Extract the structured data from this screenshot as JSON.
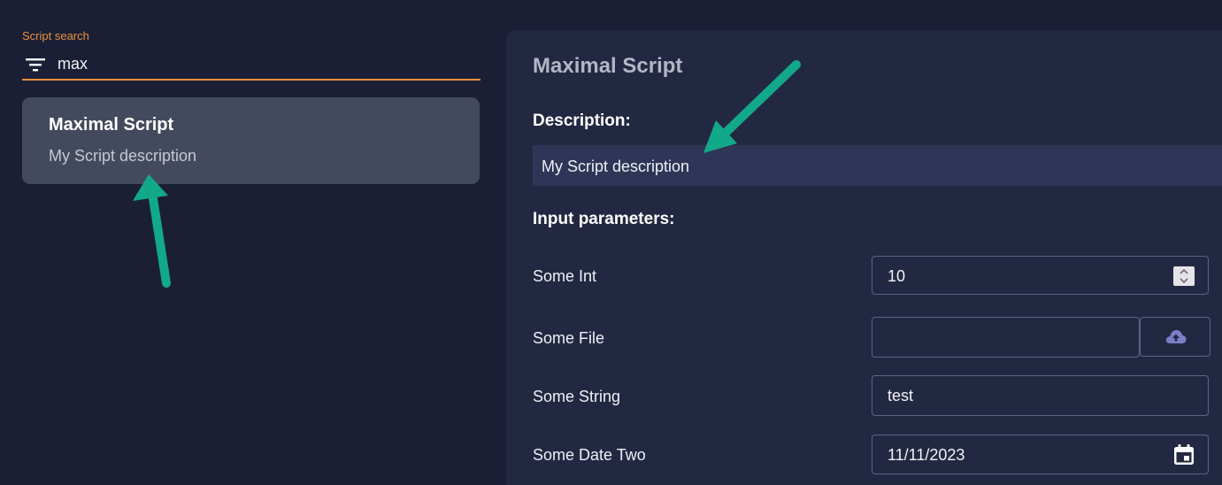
{
  "search": {
    "label": "Script search",
    "value": "max",
    "icon": "filter-icon"
  },
  "results": [
    {
      "title": "Maximal Script",
      "description": "My Script description"
    }
  ],
  "detail": {
    "title": "Maximal Script",
    "description_heading": "Description:",
    "description": "My Script description",
    "params_heading": "Input parameters:",
    "params": [
      {
        "label": "Some Int",
        "value": "10",
        "control": "number"
      },
      {
        "label": "Some File",
        "value": "",
        "control": "file",
        "icon": "cloud-upload-icon"
      },
      {
        "label": "Some String",
        "value": "test",
        "control": "text"
      },
      {
        "label": "Some Date Two",
        "value": "11/11/2023",
        "control": "date",
        "icon": "calendar-icon"
      }
    ]
  },
  "colors": {
    "background": "#1b1f36",
    "panel": "#232842",
    "accent": "#e8903c",
    "annotation_arrow": "#12a98a",
    "upload_icon": "#7a7fc8"
  }
}
